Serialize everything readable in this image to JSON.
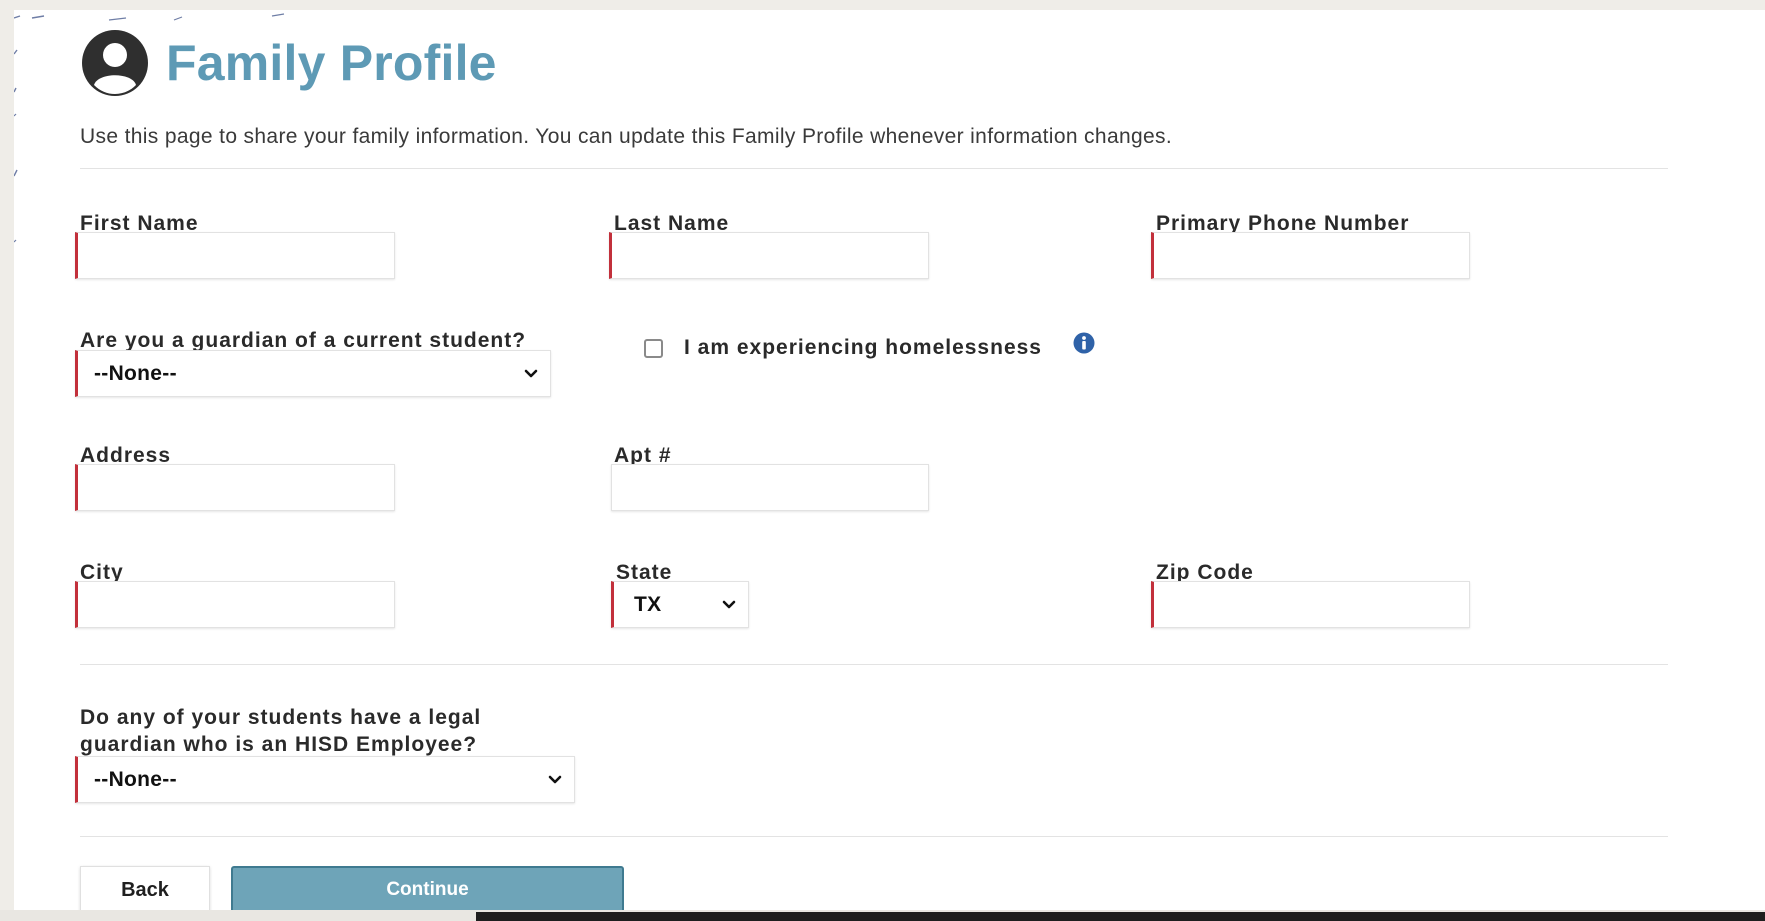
{
  "header": {
    "title": "Family Profile",
    "icon": "user-circle-icon",
    "intro": "Use this page to share your family information. You can update this Family Profile whenever information changes."
  },
  "form": {
    "first_name": {
      "label": "First Name",
      "value": ""
    },
    "last_name": {
      "label": "Last Name",
      "value": ""
    },
    "primary_phone": {
      "label": "Primary Phone Number",
      "value": ""
    },
    "guardian_current_student": {
      "label": "Are you a guardian of a current student?",
      "selected": "--None--"
    },
    "homelessness": {
      "label": "I am experiencing homelessness",
      "checked": false,
      "info_icon": "info-icon"
    },
    "address": {
      "label": "Address",
      "value": ""
    },
    "apt": {
      "label": "Apt #",
      "value": ""
    },
    "city": {
      "label": "City",
      "value": ""
    },
    "state": {
      "label": "State",
      "selected": "TX"
    },
    "zip": {
      "label": "Zip Code",
      "value": ""
    },
    "hisd_employee": {
      "label_line1": "Do any of your students have a legal",
      "label_line2": "guardian who is an HISD Employee?",
      "selected": "--None--"
    }
  },
  "actions": {
    "back_label": "Back",
    "continue_label": "Continue"
  },
  "colors": {
    "title": "#5e9ab5",
    "required_marker": "#c2303b",
    "continue_button": "#6ea4b8",
    "info_icon": "#2f62a8"
  }
}
